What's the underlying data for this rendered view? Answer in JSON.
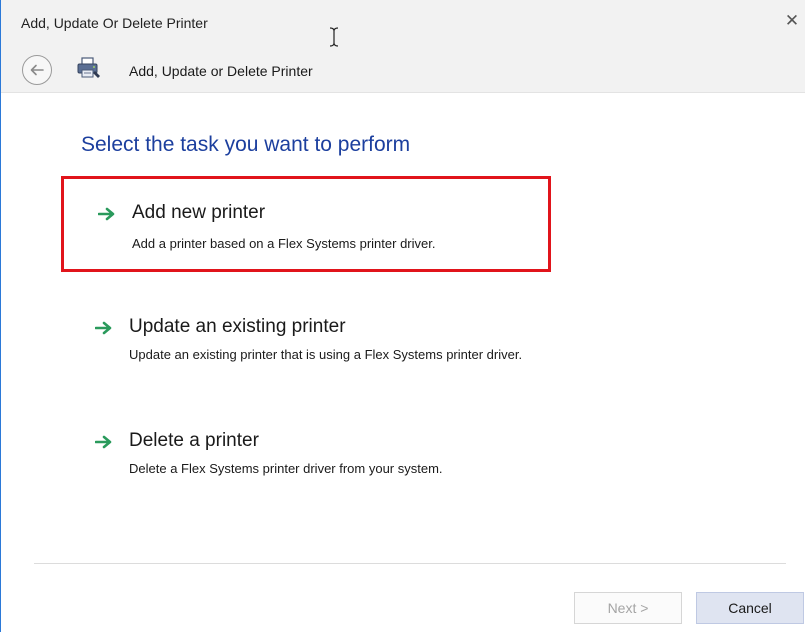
{
  "window": {
    "title": "Add, Update Or Delete Printer",
    "close_glyph": "✕"
  },
  "navbar": {
    "back_icon": "back-arrow-icon",
    "app_icon": "printer-wizard-icon",
    "title": "Add,  Update or Delete Printer"
  },
  "main": {
    "heading": "Select the task you want to perform",
    "tasks": [
      {
        "title": "Add new printer",
        "description": "Add a printer based on a Flex Systems printer driver.",
        "highlighted": true
      },
      {
        "title": "Update an existing printer",
        "description": "Update an existing printer that is using a Flex Systems printer driver.",
        "highlighted": false
      },
      {
        "title": "Delete a printer",
        "description": "Delete a Flex Systems printer driver from your system.",
        "highlighted": false
      }
    ]
  },
  "footer": {
    "next_label": "Next >",
    "next_enabled": false,
    "cancel_label": "Cancel"
  },
  "colors": {
    "heading": "#1c3f9e",
    "arrow": "#2a9a5c",
    "highlight_border": "#e1141b",
    "cancel_bg": "#dfe4f1"
  }
}
